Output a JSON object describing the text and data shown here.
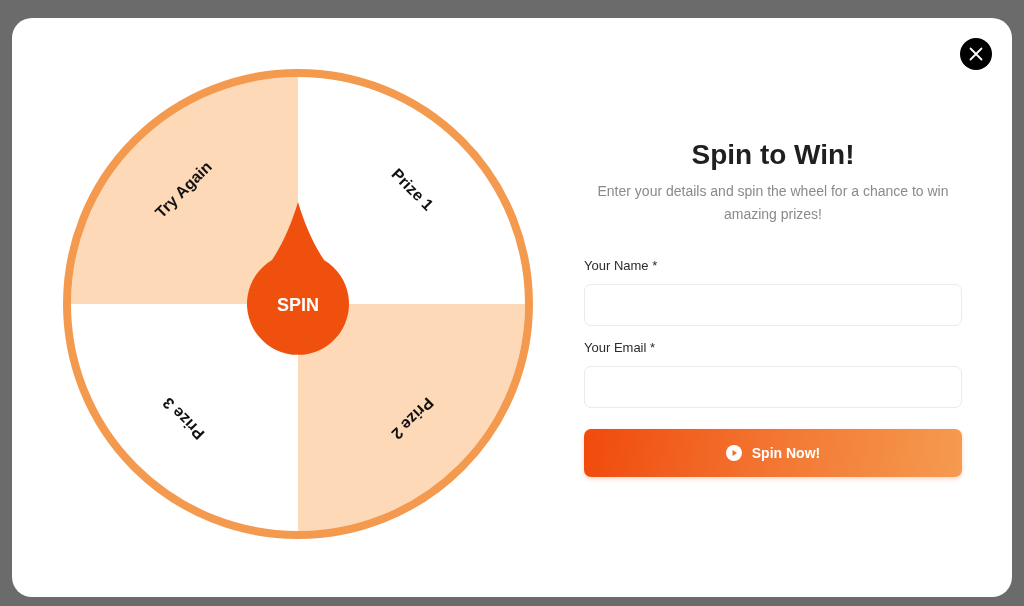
{
  "wheel": {
    "segments": [
      {
        "label": "Try Again",
        "color": "#fdd9b8"
      },
      {
        "label": "Prize 1",
        "color": "#ffffff"
      },
      {
        "label": "Prize 2",
        "color": "#fdd9b8"
      },
      {
        "label": "Prize 3",
        "color": "#ffffff"
      }
    ],
    "spin_button": {
      "label": "SPIN"
    }
  },
  "title": "Spin to Win!",
  "subtitle": "Enter your details and spin the wheel for a chance to win amazing prizes!",
  "form": {
    "fields": [
      {
        "label": "Your Name *"
      },
      {
        "label": "Your Email *"
      }
    ],
    "submit": {
      "label": "Spin Now!"
    }
  }
}
